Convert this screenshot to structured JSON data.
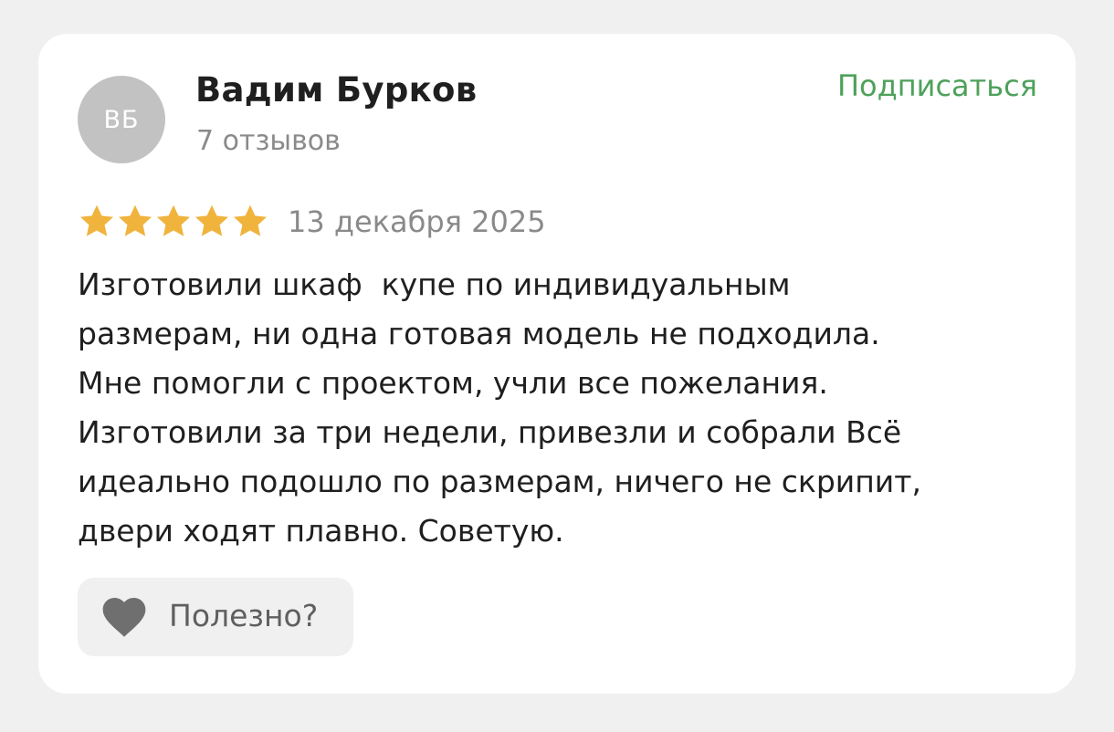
{
  "review": {
    "author": {
      "initials": "ВБ",
      "name": "Вадим Бурков",
      "review_count": "7 отзывов"
    },
    "subscribe_label": "Подписаться",
    "rating": {
      "value": 5,
      "max": 5
    },
    "date": "13 декабря 2025",
    "text_lines": [
      "Изготовили шкаф  купе по индивидуальным",
      "размерам, ни одна готовая модель не подходила.",
      "Мне помогли с проектом, учли все пожелания.",
      "Изготовили за три недели, привезли и собрали Всё",
      "идеально подошло по размерам, ничего не скрипит,",
      "двери ходят плавно. Советую."
    ],
    "helpful": {
      "label": "Полезно?",
      "icon": "heart-icon"
    }
  },
  "colors": {
    "page_background": "#f0f0f0",
    "card_background": "#ffffff",
    "accent_green": "#4ea15a",
    "star": "#f0b33c",
    "avatar": "#c2c2c2",
    "muted_text": "#8a8a8a",
    "heart": "#6f6f6f"
  }
}
